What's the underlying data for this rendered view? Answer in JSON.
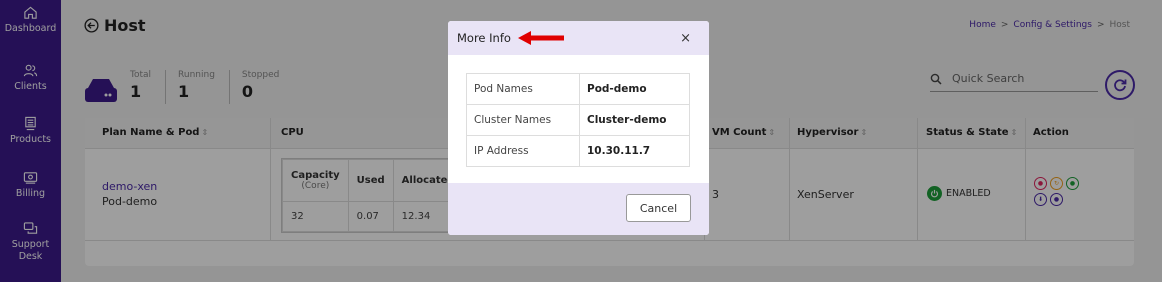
{
  "sidebar": {
    "items": [
      {
        "label": "Dashboard",
        "icon": "home-icon"
      },
      {
        "label": "Clients",
        "icon": "users-icon"
      },
      {
        "label": "Products",
        "icon": "server-icon"
      },
      {
        "label": "Billing",
        "icon": "billing-icon"
      },
      {
        "label": "Support",
        "label2": "Desk",
        "icon": "support-desk-icon"
      }
    ]
  },
  "header": {
    "title": "Host",
    "breadcrumb": {
      "home": "Home",
      "sep": ">",
      "config": "Config & Settings",
      "current": "Host"
    }
  },
  "stats": {
    "total_label": "Total",
    "total": "1",
    "running_label": "Running",
    "running": "1",
    "stopped_label": "Stopped",
    "stopped": "0"
  },
  "search": {
    "placeholder": "Quick Search"
  },
  "table": {
    "headers": {
      "plan": "Plan Name & Pod",
      "cpu": "CPU",
      "vm_count": "VM Count",
      "hypervisor": "Hypervisor",
      "status": "Status & State",
      "action": "Action"
    },
    "sort_glyph": "⇕",
    "cpu_headers": {
      "capacity": "Capacity",
      "capacity_unit": "(Core)",
      "used": "Used",
      "allocated": "Allocated"
    },
    "row": {
      "name": "demo-xen",
      "pod": "Pod-demo",
      "capacity": "32",
      "used": "0.07",
      "allocated": "12.34",
      "vm_count": "3",
      "hypervisor": "XenServer",
      "status": "ENABLED"
    }
  },
  "modal": {
    "title": "More Info",
    "close": "×",
    "rows": [
      {
        "label": "Pod Names",
        "value": "Pod-demo"
      },
      {
        "label": "Cluster Names",
        "value": "Cluster-demo"
      },
      {
        "label": "IP Address",
        "value": "10.30.11.7"
      }
    ],
    "cancel_label": "Cancel"
  },
  "colors": {
    "sidebar": "#3d1a8c",
    "accent": "#4b2aa8",
    "enabled": "#1e9e3a",
    "arrow": "#e00000"
  }
}
